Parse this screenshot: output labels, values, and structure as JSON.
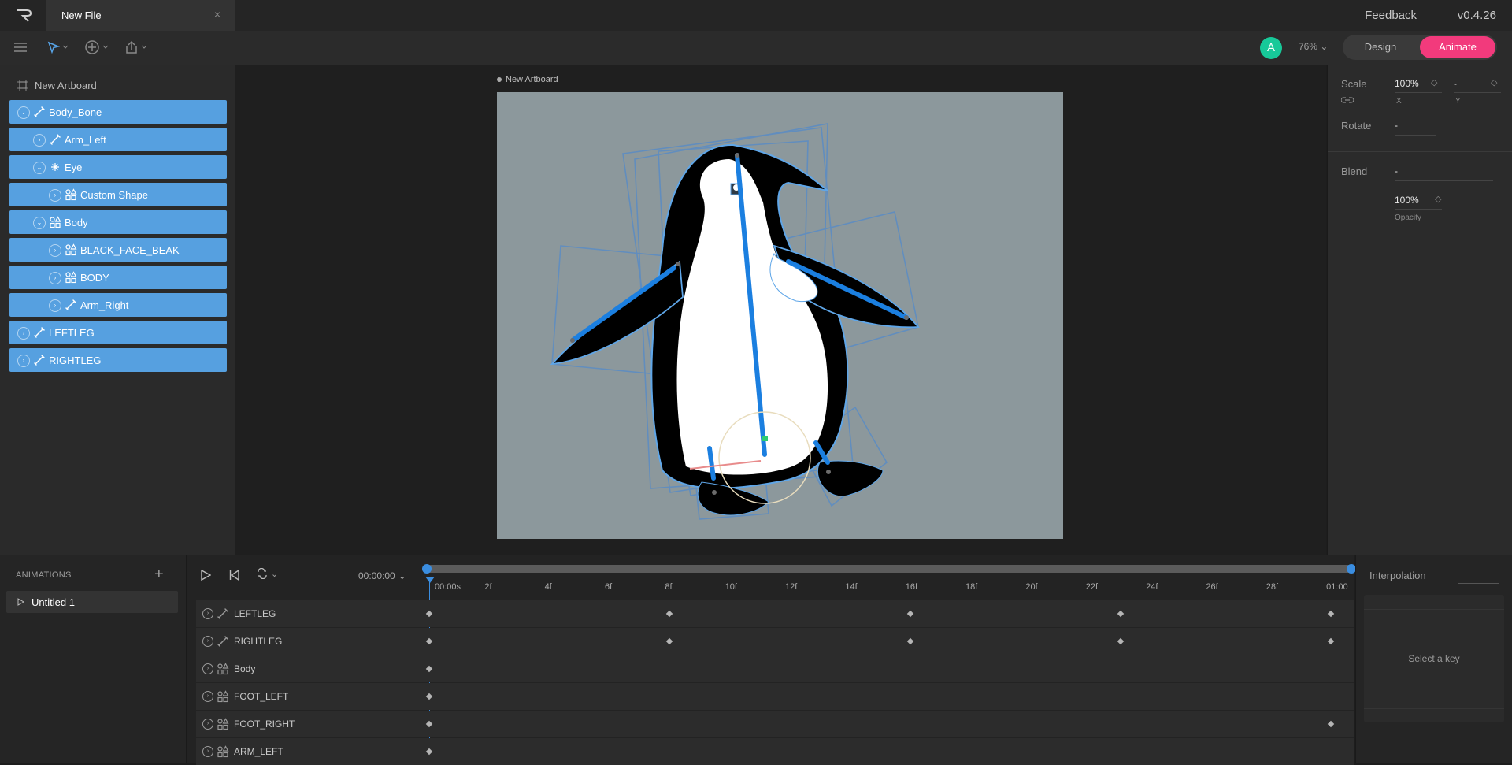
{
  "window": {
    "tab_title": "New File",
    "close_glyph": "×",
    "feedback": "Feedback",
    "version": "v0.4.26"
  },
  "toolbar": {
    "avatar_letter": "A",
    "zoom": "76%",
    "mode_design": "Design",
    "mode_animate": "Animate",
    "accent_color": "#f23a7c",
    "avatar_color": "#17c999"
  },
  "hierarchy": {
    "artboard": "New Artboard",
    "selection_color": "#56a0e0",
    "rows": [
      {
        "label": "Body_Bone",
        "icon": "bone-icon",
        "expanded": true
      },
      {
        "label": "Arm_Left",
        "icon": "bone-icon",
        "expanded": false
      },
      {
        "label": "Eye",
        "icon": "node-icon",
        "expanded": true
      },
      {
        "label": "Custom Shape",
        "icon": "shape-icon",
        "expanded": false
      },
      {
        "label": "Body",
        "icon": "shape-icon",
        "expanded": true
      },
      {
        "label": "BLACK_FACE_BEAK",
        "icon": "shape-icon",
        "expanded": false
      },
      {
        "label": "BODY",
        "icon": "shape-icon",
        "expanded": false
      },
      {
        "label": "Arm_Right",
        "icon": "bone-icon",
        "expanded": false
      },
      {
        "label": "LEFTLEG",
        "icon": "bone-icon",
        "expanded": false
      },
      {
        "label": "RIGHTLEG",
        "icon": "bone-icon",
        "expanded": false
      }
    ]
  },
  "stage": {
    "artboard_label": "New Artboard",
    "artboard_color": "#8c989c"
  },
  "inspector": {
    "scale_label": "Scale",
    "scale_x": "100%",
    "scale_y": "-",
    "x_label": "X",
    "y_label": "Y",
    "rotate_label": "Rotate",
    "rotate_value": "-",
    "blend_label": "Blend",
    "blend_value": "-",
    "opacity_value": "100%",
    "opacity_label": "Opacity"
  },
  "animations": {
    "title": "ANIMATIONS",
    "add_glyph": "+",
    "items": [
      "Untitled 1"
    ]
  },
  "timeline": {
    "time": "00:00:00",
    "ruler": [
      "00:00s",
      "2f",
      "4f",
      "6f",
      "8f",
      "10f",
      "12f",
      "14f",
      "16f",
      "18f",
      "20f",
      "22f",
      "24f",
      "26f",
      "28f",
      "01:00"
    ],
    "tracks": [
      {
        "label": "LEFTLEG",
        "icon": "bone-icon",
        "keys": [
          0,
          8,
          16,
          23,
          30
        ]
      },
      {
        "label": "RIGHTLEG",
        "icon": "bone-icon",
        "keys": [
          0,
          8,
          16,
          23,
          30
        ]
      },
      {
        "label": "Body",
        "icon": "shape-icon",
        "keys": [
          0
        ]
      },
      {
        "label": "FOOT_LEFT",
        "icon": "shape-icon",
        "keys": [
          0
        ]
      },
      {
        "label": "FOOT_RIGHT",
        "icon": "shape-icon",
        "keys": [
          0,
          30
        ]
      },
      {
        "label": "ARM_LEFT",
        "icon": "shape-icon",
        "keys": [
          0
        ]
      }
    ]
  },
  "interpolation": {
    "title": "Interpolation",
    "empty": "Select a key"
  }
}
